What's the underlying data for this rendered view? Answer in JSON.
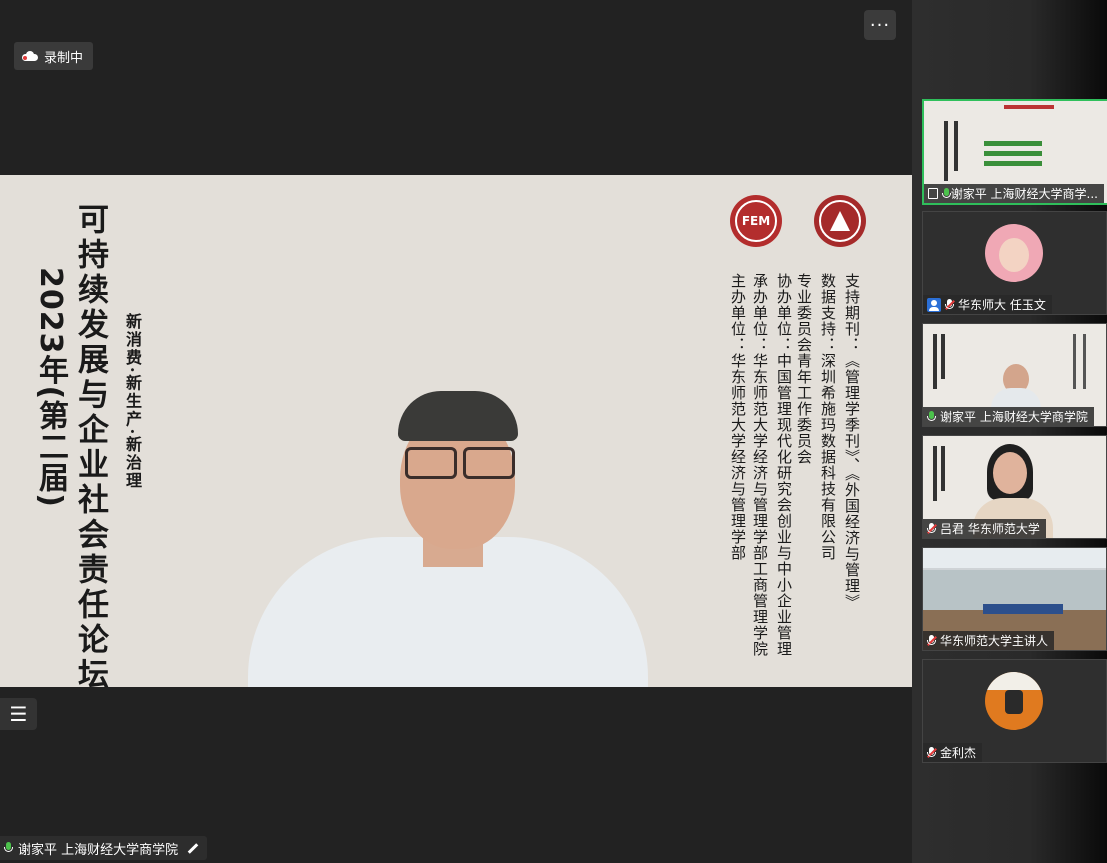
{
  "recording": {
    "label": "录制中"
  },
  "toolbar": {
    "more_label": "···"
  },
  "slide": {
    "title": "可持续发展与企业社会责任论坛",
    "subtitle": "2023年(第二届)",
    "tagline": "新消费·新生产·新治理",
    "info": [
      "支持期刊：《管理学季刊》、《外国经济与管理》",
      "数据支持：深圳希施玛数据科技有限公司",
      "专业委员会青年工作委员会",
      "协办单位：中国管理现代化研究会创业与中小企业管理",
      "承办单位：华东师范大学经济与管理学部工商管理学院",
      "主办单位：华东师范大学经济与管理学部"
    ],
    "logo_left": "FEM",
    "logo_right": "ECNU"
  },
  "main_speaker": {
    "name": "谢家平 上海财经大学商学院"
  },
  "participants": [
    {
      "name": "谢家平 上海财经大学商学...",
      "mic": "on",
      "active": true,
      "icon": "screen-share-icon"
    },
    {
      "name": "华东师大 任玉文",
      "mic": "muted",
      "icon": "person-icon"
    },
    {
      "name": "谢家平 上海财经大学商学院",
      "mic": "on"
    },
    {
      "name": "吕君 华东师范大学",
      "mic": "muted"
    },
    {
      "name": "华东师范大学主讲人",
      "mic": "muted"
    },
    {
      "name": "金利杰",
      "mic": "muted"
    }
  ],
  "colors": {
    "active_border": "#2fbf5b",
    "mic_on": "#4cc24c",
    "mic_muted": "#e23b3b",
    "slide_bg": "#e3dfd9"
  }
}
